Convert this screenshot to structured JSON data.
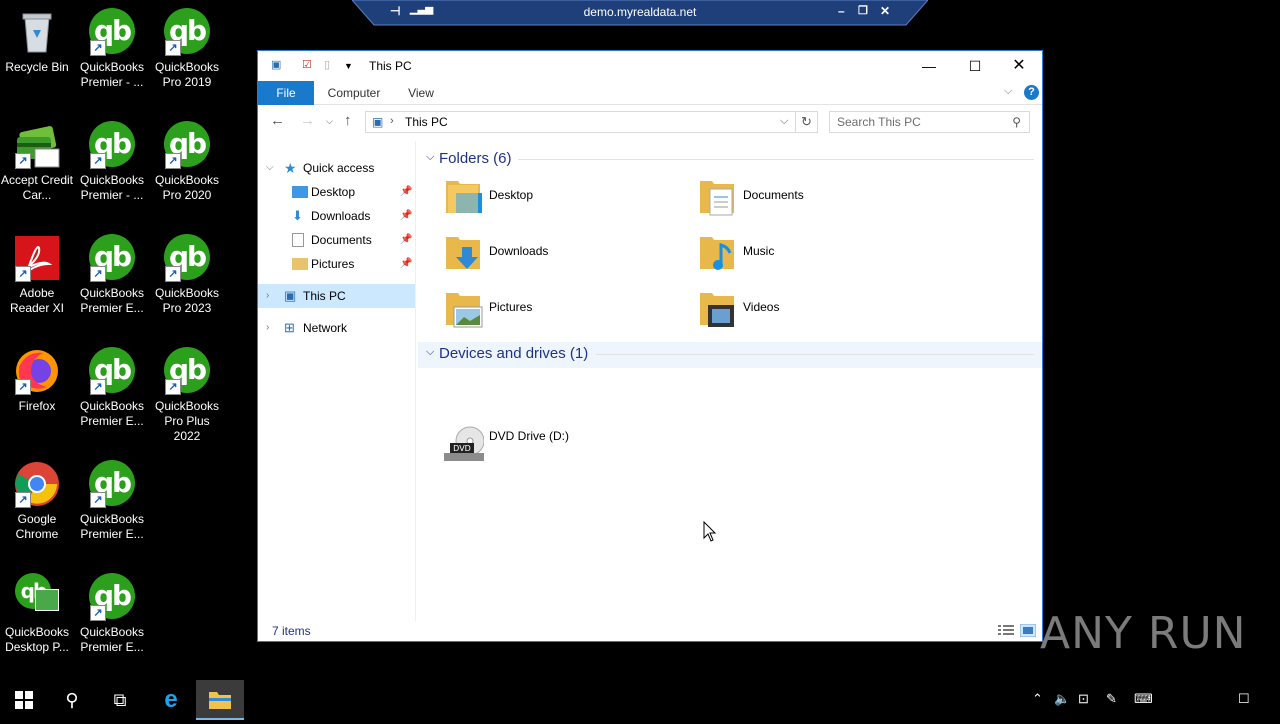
{
  "desktop": {
    "icons": [
      {
        "label": "Recycle Bin",
        "icon": "recycle-bin-icon"
      },
      {
        "label": "Accept Credit Car...",
        "icon": "credit-card-icon"
      },
      {
        "label": "Adobe Reader XI",
        "icon": "adobe-reader-icon"
      },
      {
        "label": "Firefox",
        "icon": "firefox-icon"
      },
      {
        "label": "Google Chrome",
        "icon": "chrome-icon"
      },
      {
        "label": "QuickBooks Desktop P...",
        "icon": "quickbooks-desktop-icon"
      },
      {
        "label": "QuickBooks Premier - ...",
        "icon": "quickbooks-icon"
      },
      {
        "label": "QuickBooks Premier - ...",
        "icon": "quickbooks-icon"
      },
      {
        "label": "QuickBooks Premier E...",
        "icon": "quickbooks-icon"
      },
      {
        "label": "QuickBooks Premier E...",
        "icon": "quickbooks-icon"
      },
      {
        "label": "QuickBooks Premier E...",
        "icon": "quickbooks-icon"
      },
      {
        "label": "QuickBooks Premier E...",
        "icon": "quickbooks-icon"
      },
      {
        "label": "QuickBooks Pro 2019",
        "icon": "quickbooks-icon"
      },
      {
        "label": "QuickBooks Pro 2020",
        "icon": "quickbooks-icon"
      },
      {
        "label": "QuickBooks Pro 2023",
        "icon": "quickbooks-icon"
      },
      {
        "label": "QuickBooks Pro Plus 2022",
        "icon": "quickbooks-icon"
      }
    ]
  },
  "rdp": {
    "title": "demo.myrealdata.net"
  },
  "explorer": {
    "title": "This PC",
    "ribbon_tabs": [
      "File",
      "Computer",
      "View"
    ],
    "address": "This PC",
    "search_placeholder": "Search This PC",
    "nav": {
      "quick_access": "Quick access",
      "quick_items": [
        "Desktop",
        "Downloads",
        "Documents",
        "Pictures"
      ],
      "this_pc": "This PC",
      "network": "Network"
    },
    "groups": {
      "folders_title": "Folders (6)",
      "folders": [
        "Desktop",
        "Documents",
        "Downloads",
        "Music",
        "Pictures",
        "Videos"
      ],
      "devices_title": "Devices and drives (1)",
      "devices": [
        "DVD Drive (D:)"
      ]
    },
    "status": {
      "item_count": "7 items"
    }
  },
  "watermark": "ANY RUN",
  "colors": {
    "accent": "#1979ca",
    "selection": "#cce8ff",
    "header_text": "#1e3287",
    "quickbooks_green": "#2ca01c"
  }
}
